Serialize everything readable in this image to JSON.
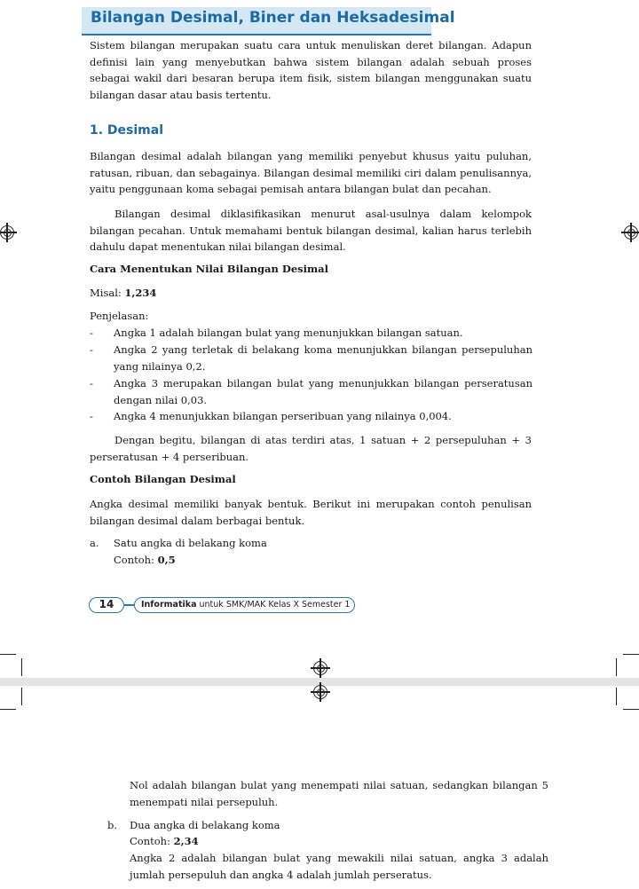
{
  "page": {
    "title": "Bilangan Desimal, Biner dan Heksadesimal",
    "intro": "Sistem bilangan merupakan suatu cara untuk menuliskan deret bilangan. Adapun definisi lain yang menyebutkan bahwa sistem bilangan adalah sebuah proses sebagai wakil dari besaran berupa item fisik, sistem bilangan menggunakan suatu bilangan dasar atau basis tertentu.",
    "section1_heading": "1. Desimal",
    "desimal_p1": "Bilangan desimal adalah bilangan yang memiliki penyebut khusus yaitu puluhan, ratusan, ribuan, dan sebagainya. Bilangan desimal memiliki ciri dalam penulisannya, yaitu penggunaan koma sebagai pemisah antara bilangan bulat dan pecahan.",
    "desimal_p2": "Bilangan desimal diklasifikasikan menurut asal-usulnya dalam kelompok bilangan pecahan. Untuk memahami bentuk bilangan desimal, kalian harus terlebih dahulu dapat menentukan nilai bilangan desimal.",
    "cara_heading": "Cara Menentukan Nilai Bilangan Desimal",
    "misal_label": "Misal:",
    "misal_value": "1,234",
    "penjelasan_label": "Penjelasan:",
    "penjelasan_items": [
      "Angka 1 adalah bilangan bulat yang menunjukkan bilangan satuan.",
      "Angka 2 yang terletak di belakang koma menunjukkan bilangan persepuluhan yang nilainya 0,2.",
      "Angka 3 merupakan bilangan bulat yang menunjukkan bilangan perseratusan dengan nilai 0,03.",
      "Angka 4 menunjukkan bilangan perseribuan yang nilainya 0,004."
    ],
    "bullet_char": "-",
    "summary": "Dengan begitu, bilangan di atas terdiri atas, 1 satuan + 2 persepuluhan + 3 perseratusan + 4 perseribuan.",
    "contoh_heading": "Contoh Bilangan Desimal",
    "contoh_p": "Angka desimal memiliki banyak bentuk. Berikut ini merupakan contoh penulisan bilangan desimal dalam berbagai bentuk.",
    "item_a_marker": "a.",
    "item_a_title": "Satu angka di belakang koma",
    "item_a_contoh_label": "Contoh:",
    "item_a_contoh_value": "0,5"
  },
  "footer": {
    "page_number": "14",
    "book_bold": "Informatika",
    "book_rest": " untuk SMK/MAK Kelas X Semester 1"
  },
  "next_page": {
    "continuation": "Nol adalah bilangan bulat yang menempati nilai satuan, sedangkan bilangan 5 menempati nilai persepuluh.",
    "item_b_marker": "b.",
    "item_b_title": "Dua angka di belakang koma",
    "item_b_contoh_label": "Contoh:",
    "item_b_contoh_value": "2,34",
    "item_b_desc": "Angka 2 adalah bilangan bulat yang mewakili nilai satuan, angka 3 adalah jumlah persepuluh dan angka 4 adalah jumlah perseratus."
  },
  "icons": [
    "registration-mark-icon"
  ]
}
